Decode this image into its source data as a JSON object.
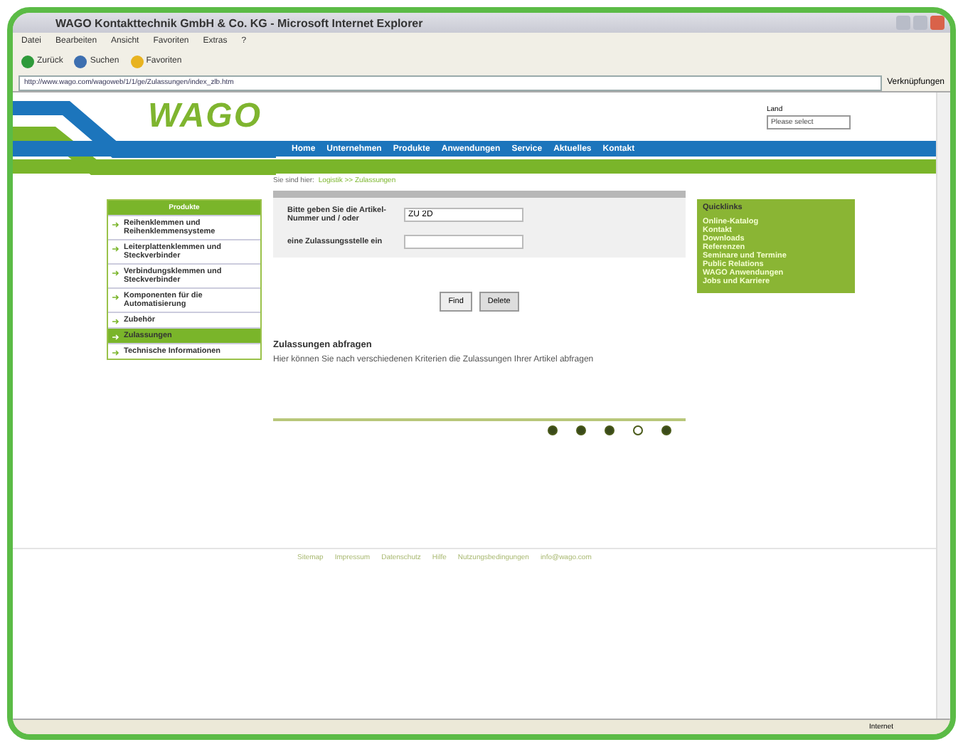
{
  "window": {
    "title": "WAGO Kontakttechnik GmbH & Co. KG - Microsoft Internet Explorer"
  },
  "menu": [
    "Datei",
    "Bearbeiten",
    "Ansicht",
    "Favoriten",
    "Extras",
    "?"
  ],
  "toolbar": [
    {
      "kind": "back",
      "label": "Zurück"
    },
    {
      "kind": "search",
      "label": "Suchen"
    },
    {
      "kind": "favorites",
      "label": "Favoriten"
    }
  ],
  "address": {
    "value": "http://www.wago.com/wagoweb/1/1/ge/Zulassungen/index_zlb.htm",
    "links": "Verknüpfungen"
  },
  "header": {
    "logo": "WAGO",
    "country_label": "Land",
    "country_value": "Please select"
  },
  "nav": [
    "Home",
    "Unternehmen",
    "Produkte",
    "Anwendungen",
    "Service",
    "Aktuelles",
    "Kontakt"
  ],
  "breadcrumb": {
    "prefix": "Sie sind hier:",
    "link": "Logistik >> Zulassungen"
  },
  "sidebar": {
    "title": "Produkte",
    "items": [
      {
        "label": "Reihenklemmen und Reihenklemmensysteme",
        "selected": false
      },
      {
        "label": "Leiterplattenklemmen und Steckverbinder",
        "selected": false
      },
      {
        "label": "Verbindungsklemmen und Steckverbinder",
        "selected": false
      },
      {
        "label": "Komponenten für die Automatisierung",
        "selected": false
      },
      {
        "label": "Zubehör",
        "selected": false
      },
      {
        "label": "Zulassungen",
        "selected": true
      },
      {
        "label": "Technische Informationen",
        "selected": false
      }
    ]
  },
  "form": {
    "fields": [
      {
        "label": "Bitte geben Sie die Artikel-Nummer und / oder",
        "value": "ZU 2D"
      },
      {
        "label": "eine Zulassungsstelle ein"
      }
    ],
    "buttons": [
      "Find",
      "Delete"
    ]
  },
  "section": {
    "heading": "Zulassungen abfragen",
    "text": "Hier können Sie nach verschiedenen Kriterien die Zulassungen Ihrer Artikel abfragen"
  },
  "quicklinks": {
    "title": "Quicklinks",
    "items": [
      "Online-Katalog",
      "Kontakt",
      "Downloads",
      "Referenzen",
      "Seminare und Termine",
      "Public Relations",
      "WAGO Anwendungen",
      "Jobs und Karriere"
    ]
  },
  "footer": [
    "Sitemap",
    "Impressum",
    "Datenschutz",
    "Hilfe",
    "Nutzungsbedingungen",
    "info@wago.com"
  ],
  "status_bar": {
    "zone": "Internet"
  }
}
